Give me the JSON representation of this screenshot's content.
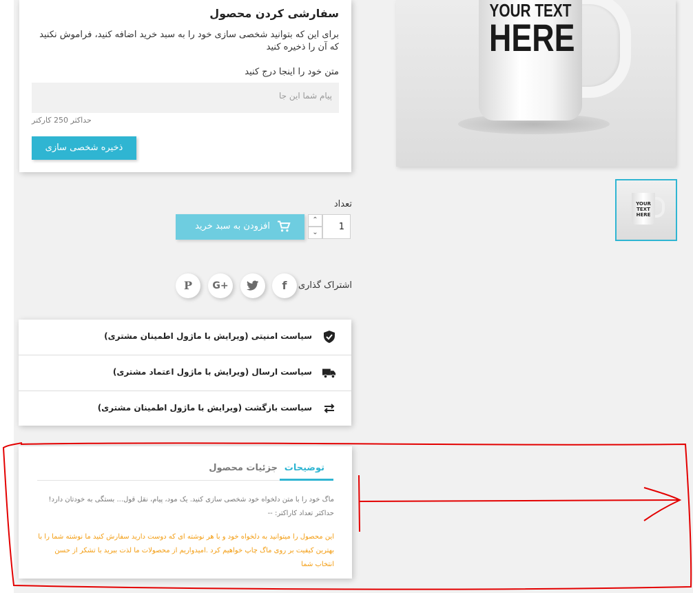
{
  "customization": {
    "title": "سفارشی کردن محصول",
    "description": "برای این که بتوانید شخصی سازی خود را به سبد خرید اضافه کنید، فراموش نکنید که آن را ذخیره کنید",
    "field_label": "متن خود را اینجا درج کنید",
    "placeholder": "پیام شما این جا",
    "max_chars": "حداکثر 250 کارکتر",
    "save_button": "ذخیره شخصی سازی"
  },
  "product_image": {
    "mug_text_line1": "YOUR TEXT",
    "mug_text_line2": "HERE",
    "thumb_text": "YOUR TEXT HERE"
  },
  "quantity": {
    "label": "تعداد",
    "value": "1"
  },
  "add_to_cart": {
    "label": "افزودن به سبد خرید",
    "icon": "cart-icon"
  },
  "share": {
    "label": "اشتراک گذاری",
    "networks": [
      "facebook",
      "twitter",
      "google-plus",
      "pinterest"
    ]
  },
  "reassurance": [
    {
      "icon": "shield-check-icon",
      "text": "سیاست امنیتی (ویرایش با ماژول اطمینان مشتری)"
    },
    {
      "icon": "truck-icon",
      "text": "سیاست ارسال (ویرایش با ماژول اعتماد مشتری)"
    },
    {
      "icon": "swap-arrows-icon",
      "text": "سیاست بازگشت (ویرایش با ماژول اطمینان مشتری)"
    }
  ],
  "tabs": {
    "items": [
      "توضیحات",
      "جزئیات محصول"
    ],
    "active": "توضیحات",
    "paragraph1": "ماگ خود را با متن دلخواه خود شخصی سازی کنید. یک مود، پیام، نقل قول... بستگی به خودتان دارد! حداکثر تعداد کاراکتر: --",
    "paragraph2": "این محصول را میتوانید به دلخواه خود و با هر نوشته ای که دوست دارید سفارش کنید ما نوشته شما را با بهترین کیفیت بر روی ماگ چاپ خواهیم کرد .امیدواریم از محصولات ما لذت ببرید با تشکر از حسن انتخاب شما"
  },
  "colors": {
    "accent": "#2fb5d2",
    "accent_light": "#6ecde0",
    "note_orange": "#f39d12",
    "annotation_red": "#e30000"
  }
}
